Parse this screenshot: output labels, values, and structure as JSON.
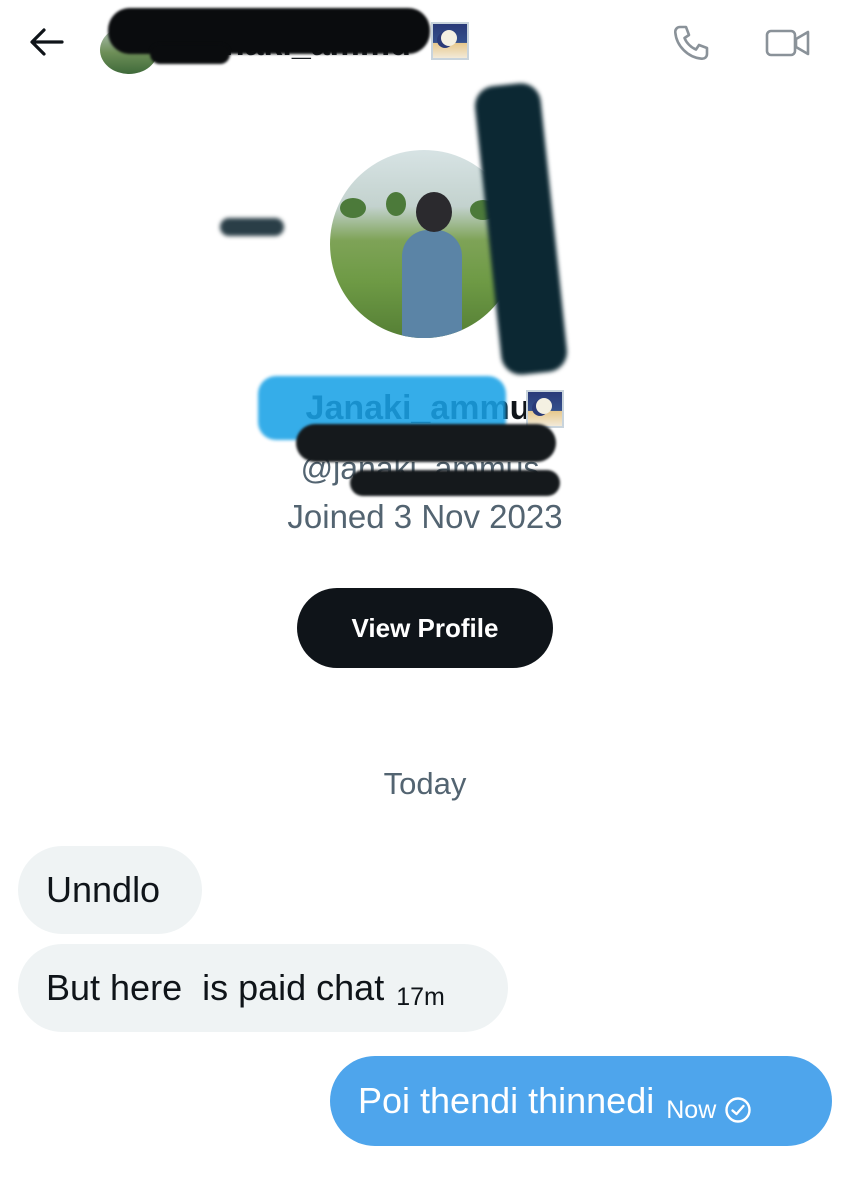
{
  "header": {
    "contact_name": "Janaki_ammu",
    "back_icon": "arrow-left-icon",
    "call_icon": "phone-icon",
    "video_icon": "video-camera-icon"
  },
  "profile": {
    "display_name": "Janaki_ammu",
    "handle": "@janaki_ammus",
    "joined": "Joined 3 Nov 2023",
    "view_profile_label": "View Profile"
  },
  "conversation": {
    "day_label": "Today",
    "messages": [
      {
        "direction": "incoming",
        "text": "Unndlo"
      },
      {
        "direction": "incoming",
        "text": "But here  is paid chat",
        "time": "17m"
      },
      {
        "direction": "outgoing",
        "text": "Poi thendi thinnedi",
        "time": "Now",
        "status_icon": "sent-check-icon"
      }
    ]
  },
  "colors": {
    "outgoing_bubble": "#4ea5ec",
    "incoming_bubble": "#eff3f4",
    "primary_button": "#0f1419",
    "secondary_text": "#536471"
  }
}
